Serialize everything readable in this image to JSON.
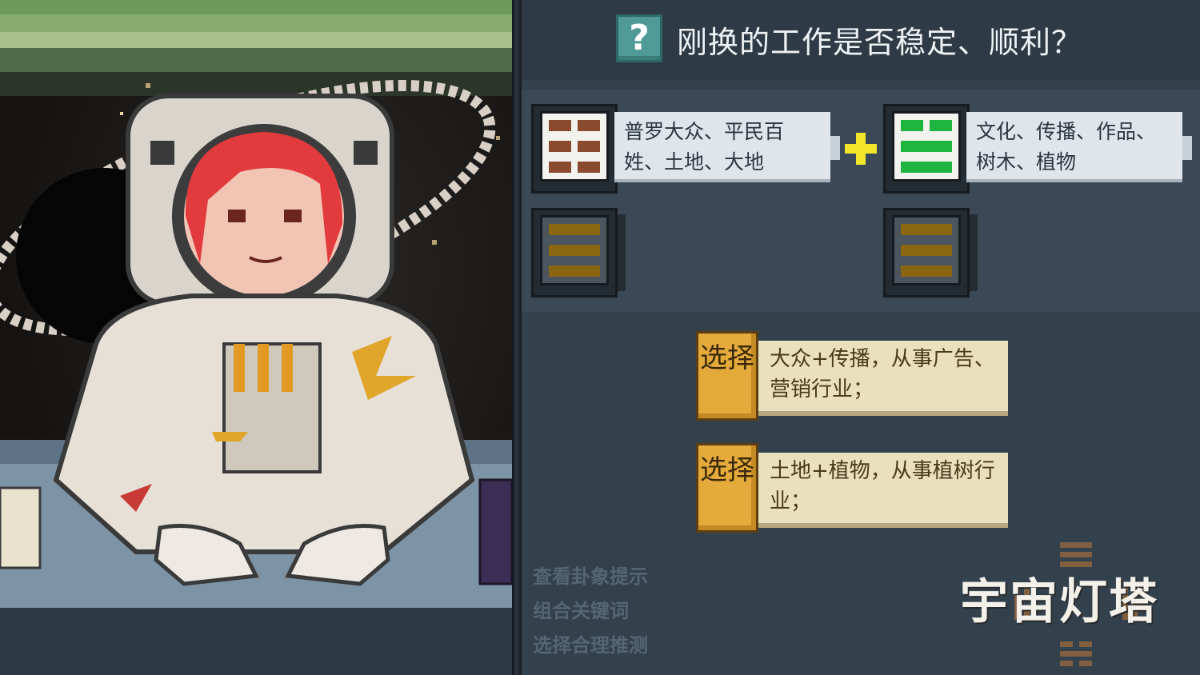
{
  "question": {
    "icon": "question-mark-icon",
    "icon_glyph": "?",
    "text": "刚换的工作是否稳定、顺利？"
  },
  "trigrams": {
    "upper_left": {
      "label": "普罗大众、平民百姓、土地、大地",
      "color": "#8a4a2e"
    },
    "upper_right": {
      "label": "文化、传播、作品、树木、植物",
      "color": "#1fb33f"
    },
    "lower_left": {
      "color": "#8a6512"
    },
    "lower_right": {
      "color": "#8a6512"
    }
  },
  "operator": "plus-icon",
  "choices": [
    {
      "badge": "选择",
      "text": "大众+传播，从事广告、营销行业；"
    },
    {
      "badge": "选择",
      "text": "土地+植物，从事植树行业；"
    }
  ],
  "hints": [
    "查看卦象提示",
    "组合关键词",
    "选择合理推测"
  ],
  "brand": {
    "name": "宇宙灯塔",
    "emblem": "bagua-icon"
  },
  "colors": {
    "panel": "#33414d",
    "accent_yellow": "#f2e52a",
    "badge_orange": "#e4aa3b",
    "teal": "#4f9a97"
  }
}
